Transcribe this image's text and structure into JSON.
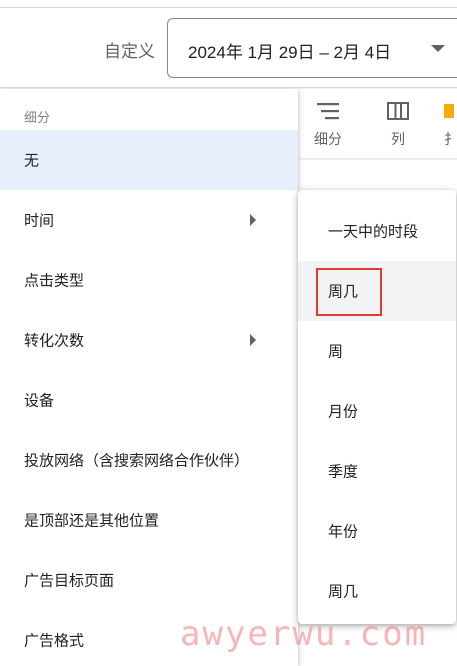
{
  "header": {
    "custom_label": "自定义",
    "date_range": "2024年 1月 29日 – 2月 4日"
  },
  "toolbar": {
    "segment_label": "细分",
    "columns_label": "列",
    "partial_label": "扌"
  },
  "menu": {
    "header": "细分",
    "items": [
      {
        "label": "无",
        "selected": true,
        "has_submenu": false
      },
      {
        "label": "时间",
        "selected": false,
        "has_submenu": true
      },
      {
        "label": "点击类型",
        "selected": false,
        "has_submenu": false
      },
      {
        "label": "转化次数",
        "selected": false,
        "has_submenu": true
      },
      {
        "label": "设备",
        "selected": false,
        "has_submenu": false
      },
      {
        "label": "投放网络（含搜索网络合作伙伴）",
        "selected": false,
        "has_submenu": false
      },
      {
        "label": "是顶部还是其他位置",
        "selected": false,
        "has_submenu": false
      },
      {
        "label": "广告目标页面",
        "selected": false,
        "has_submenu": false
      },
      {
        "label": "广告格式",
        "selected": false,
        "has_submenu": false
      }
    ]
  },
  "submenu": {
    "items": [
      {
        "label": "一天中的时段"
      },
      {
        "label": "周几",
        "highlighted": true
      },
      {
        "label": "周"
      },
      {
        "label": "月份"
      },
      {
        "label": "季度"
      },
      {
        "label": "年份"
      },
      {
        "label": "周几"
      }
    ]
  },
  "watermark": "awyerwu.com",
  "colors": {
    "selected_bg": "#e8f0fe",
    "highlight_border": "#e53935",
    "toolbar_accent": "#f9ab00"
  }
}
